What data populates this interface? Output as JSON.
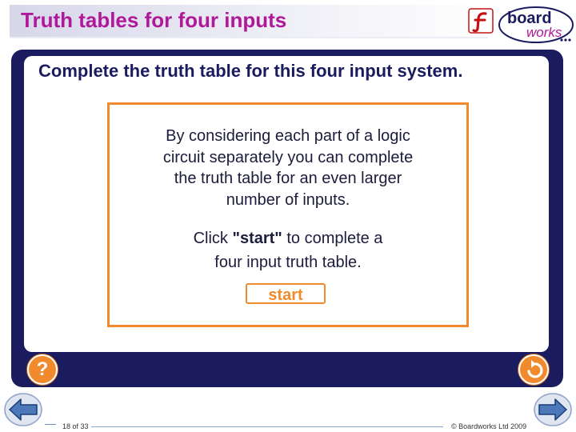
{
  "header": {
    "title": "Truth tables for four inputs",
    "logo_text_top": "board",
    "logo_text_bottom": "works"
  },
  "panel": {
    "heading": "Complete the truth table for this four input system.",
    "paragraph1_lines": [
      "By considering each part of a logic",
      "circuit separately you can complete",
      "the truth table for an even larger",
      "number of inputs."
    ],
    "paragraph2_line1_pre": "Click ",
    "paragraph2_line1_bold": "\"start\"",
    "paragraph2_line1_post": " to complete a",
    "paragraph2_line2": "four input truth table.",
    "start_label": "start",
    "help_label": "?"
  },
  "footer": {
    "page_count": "18 of 33",
    "copyright": "© Boardworks Ltd 2009"
  },
  "colors": {
    "title": "#b0189a",
    "panel": "#1b1c60",
    "accent_orange": "#f08a2c",
    "nav_arrow": "#4a78b8"
  },
  "icons": {
    "help": "question-mark-icon",
    "back": "return-arrow-icon",
    "prev": "left-arrow-icon",
    "next": "right-arrow-icon"
  }
}
